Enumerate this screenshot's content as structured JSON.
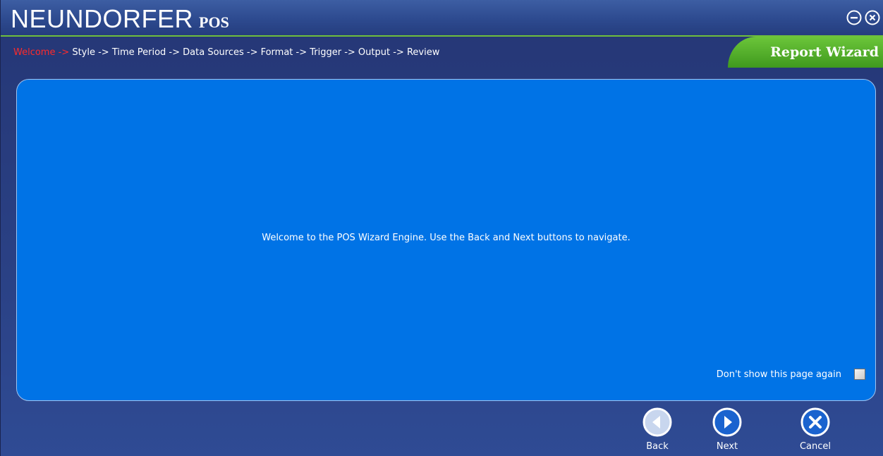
{
  "app": {
    "brand_main": "NEUNDORFER",
    "brand_sub": "POS"
  },
  "window_controls": {
    "minimize_icon": "minus-circle-icon",
    "close_icon": "x-circle-icon"
  },
  "breadcrumb": {
    "active": "Welcome ->",
    "rest": " Style -> Time Period -> Data Sources -> Format -> Trigger -> Output -> Review"
  },
  "wizard_tab": {
    "label": "Report Wizard"
  },
  "content": {
    "welcome_message": "Welcome to the POS Wizard Engine. Use the Back and Next buttons to navigate.",
    "dont_show_label": "Don't show this page again",
    "dont_show_checked": false
  },
  "nav": {
    "back_label": "Back",
    "next_label": "Next",
    "cancel_label": "Cancel"
  },
  "colors": {
    "panel": "#0073e6",
    "accent_green": "#6cc63a",
    "active_crumb": "#ff2a2a",
    "window_bg": "#2a4185"
  }
}
